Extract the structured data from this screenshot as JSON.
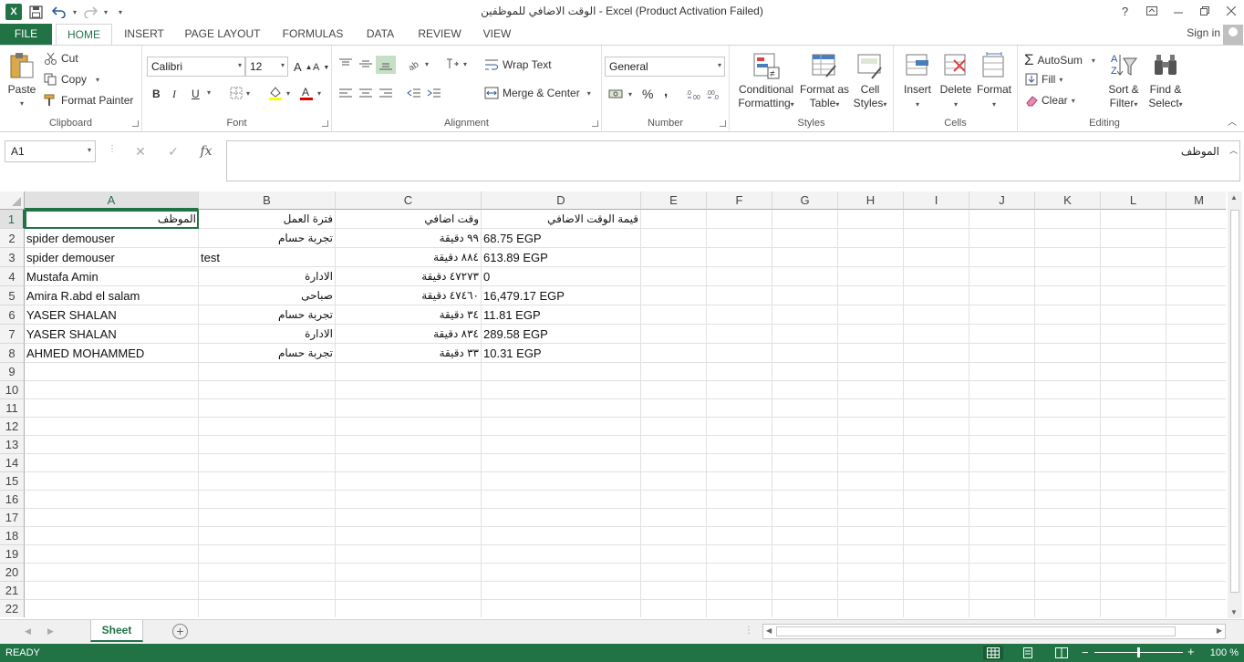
{
  "window": {
    "title": "الوقت الاضافي للموظفين - Excel (Product Activation Failed)",
    "help": "?",
    "excel_logo": "X"
  },
  "tabs": [
    "FILE",
    "HOME",
    "INSERT",
    "PAGE LAYOUT",
    "FORMULAS",
    "DATA",
    "REVIEW",
    "VIEW"
  ],
  "active_tab": "HOME",
  "signin": "Sign in",
  "ribbon": {
    "clipboard": {
      "label": "Clipboard",
      "paste": "Paste",
      "cut": "Cut",
      "copy": "Copy",
      "format_painter": "Format Painter"
    },
    "font": {
      "label": "Font",
      "name": "Calibri",
      "size": "12",
      "bold": "B",
      "italic": "I",
      "underline": "U",
      "grow": "A",
      "shrink": "A"
    },
    "alignment": {
      "label": "Alignment",
      "wrap_text": "Wrap Text",
      "merge_center": "Merge & Center"
    },
    "number": {
      "label": "Number",
      "format": "General",
      "percent": "%",
      "comma": ","
    },
    "styles": {
      "label": "Styles",
      "conditional": "Conditional",
      "formatting": "Formatting",
      "format_as": "Format as",
      "table": "Table",
      "cell": "Cell",
      "cell_styles": "Styles"
    },
    "cells": {
      "label": "Cells",
      "insert": "Insert",
      "delete": "Delete",
      "format": "Format"
    },
    "editing": {
      "label": "Editing",
      "autosum": "AutoSum",
      "fill": "Fill",
      "clear": "Clear",
      "sort": "Sort &",
      "filter": "Filter",
      "find": "Find &",
      "select": "Select"
    }
  },
  "formula_bar": {
    "namebox": "A1",
    "fx": "fx",
    "value": "الموظف"
  },
  "columns": [
    "A",
    "B",
    "C",
    "D",
    "E",
    "F",
    "G",
    "H",
    "I",
    "J",
    "K",
    "L",
    "M"
  ],
  "rows": [
    "1",
    "2",
    "3",
    "4",
    "5",
    "6",
    "7",
    "8",
    "9",
    "10",
    "11",
    "12",
    "13",
    "14",
    "15",
    "16",
    "17",
    "18",
    "19",
    "20",
    "21",
    "22"
  ],
  "cells": [
    [
      "الموظف",
      "فترة العمل",
      "وقت اضافي",
      "قيمة الوقت الاضافي"
    ],
    [
      "spider demouser",
      "تجربة حسام",
      "٩٩ دقيقة",
      "68.75 EGP"
    ],
    [
      "spider demouser",
      "test",
      "٨٨٤ دقيقة",
      "613.89 EGP"
    ],
    [
      "Mustafa Amin",
      "الادارة",
      "٤٧٢٧٣ دقيقة",
      "0"
    ],
    [
      "Amira R.abd el salam",
      "صباحى",
      "٤٧٤٦٠ دقيقة",
      "16,479.17 EGP"
    ],
    [
      "YASER SHALAN",
      "تجربة حسام",
      "٣٤ دقيقة",
      "11.81 EGP"
    ],
    [
      "YASER SHALAN",
      "الادارة",
      "٨٣٤ دقيقة",
      "289.58 EGP"
    ],
    [
      "AHMED MOHAMMED",
      "تجربة حسام",
      "٣٣ دقيقة",
      "10.31 EGP"
    ]
  ],
  "sheet_tab": "Sheet",
  "status": {
    "text": "READY",
    "zoom": "100 %"
  },
  "colors": {
    "accent": "#217346",
    "grid": "#e1e1e1"
  }
}
